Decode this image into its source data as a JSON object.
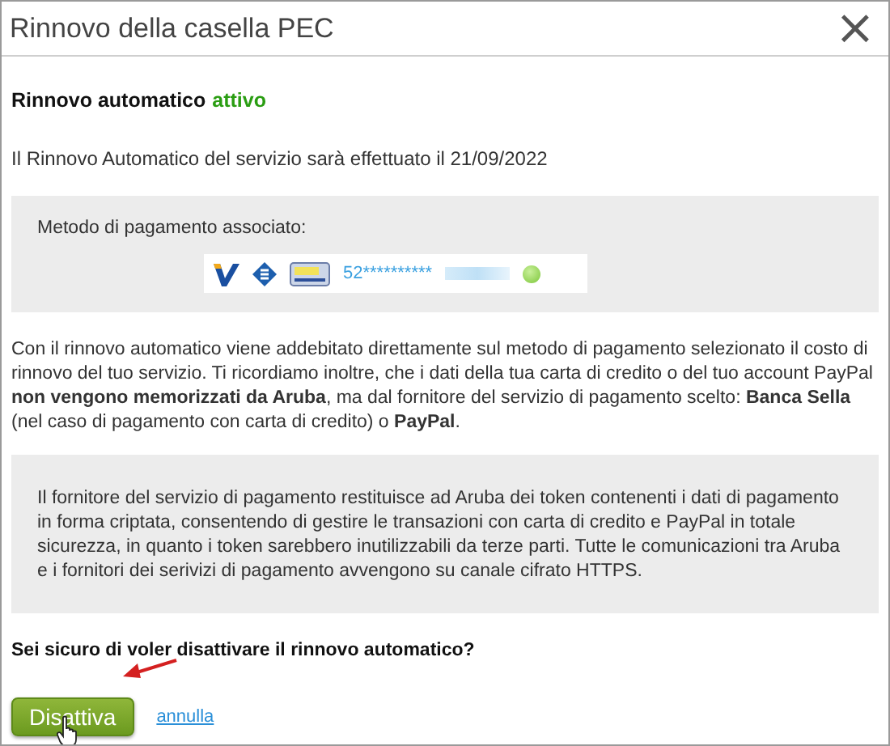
{
  "window": {
    "title": "Rinnovo della casella PEC",
    "close": "×"
  },
  "status": {
    "label": "Rinnovo automatico",
    "value": "attivo",
    "active": true
  },
  "renewal_date_text": "Il Rinnovo Automatico del servizio sarà effettuato il 21/09/2022",
  "payment": {
    "label": "Metodo di pagamento associato:",
    "card_number": "52**********"
  },
  "explanation": "Con il rinnovo automatico viene addebitato direttamente sul metodo di pagamento selezionato il costo di rinnovo del tuo servizio. Ti ricordiamo inoltre, che i dati della tua carta di credito o del tuo account PayPal **non vengono memorizzati da Aruba**, ma dal fornitore del servizio di pagamento scelto: **Banca Sella** (nel caso di pagamento con carta di credito) o **PayPal**.",
  "security_note": "Il fornitore del servizio di pagamento restituisce ad Aruba dei token contenenti i dati di pagamento in forma criptata, consentendo di gestire le transazioni con carta di credito e PayPal in totale sicurezza, in quanto i token sarebbero inutilizzabili da terze parti. Tutte le comunicazioni tra Aruba e i fornitori dei serivizi di pagamento avvengono su canale cifrato HTTPS.",
  "question": "Sei sicuro di voler disattivare il rinnovo automatico?",
  "actions": [
    {
      "kind": "button",
      "label": "Disattiva"
    },
    {
      "kind": "link",
      "label": "annulla"
    }
  ]
}
